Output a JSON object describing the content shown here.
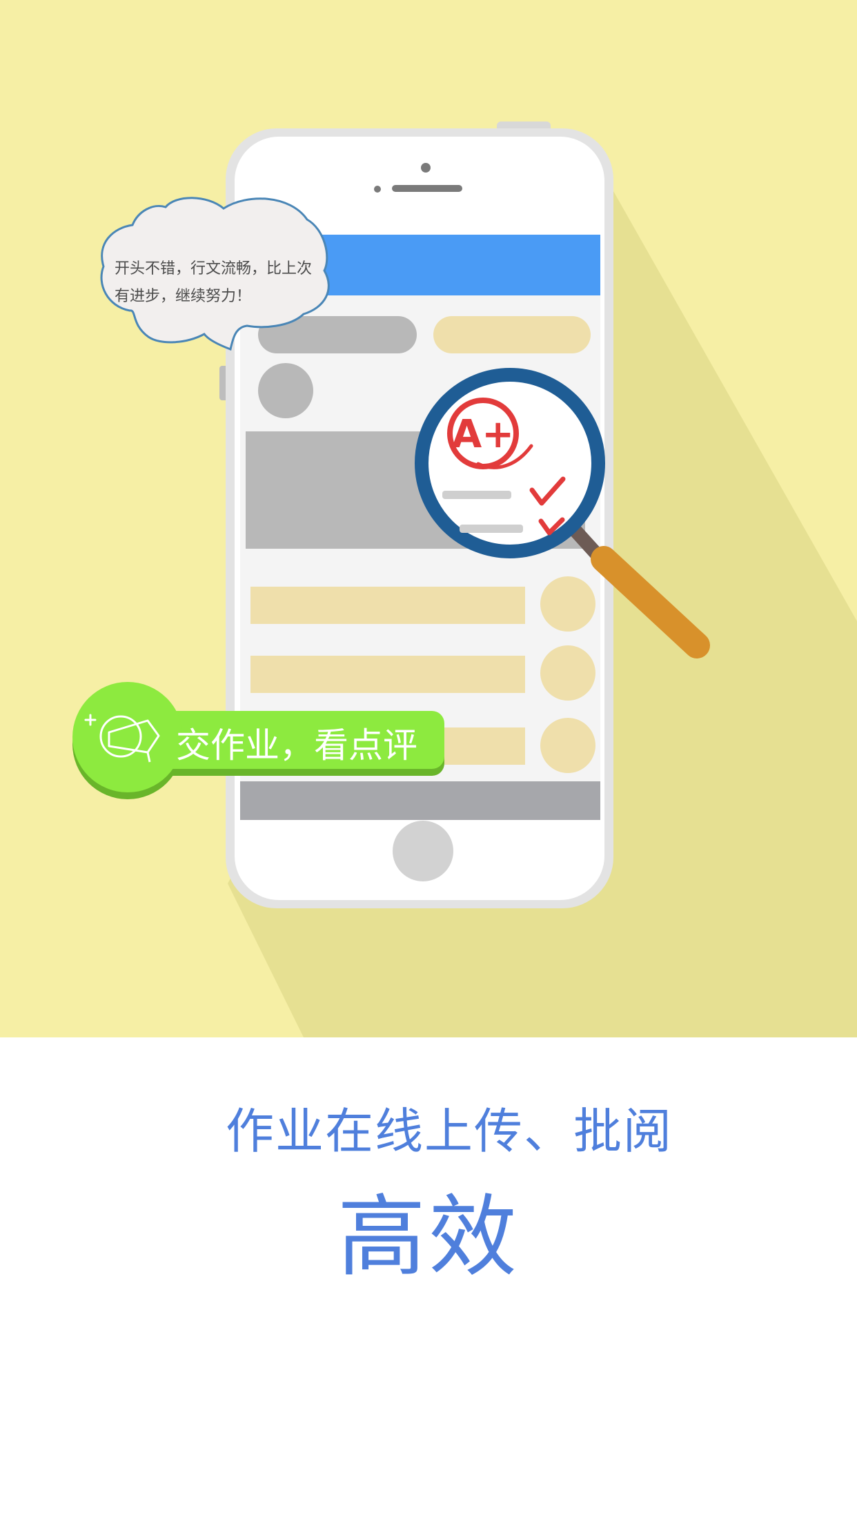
{
  "illustration": {
    "comment_bubble": {
      "text": "开头不错，行文流畅，比上次\n有进步，继续努力！"
    },
    "grade_badge": {
      "text": "A+"
    },
    "action_badge": {
      "label": "交作业，看点评"
    }
  },
  "content": {
    "subtitle": "作业在线上传、批阅",
    "headline": "高效"
  },
  "colors": {
    "hero_background": "#f6efa5",
    "brand_blue": "#4f7fdc",
    "phone_header_blue": "#4a9bf5",
    "badge_green": "#8dea3f",
    "magnifier_blue": "#1f5d95",
    "magnifier_handle": "#d8912b",
    "grade_red": "#e23b3b"
  },
  "icons": {
    "badge_icon": "megaphone-icon",
    "magnifier_icon": "magnifier-icon"
  }
}
